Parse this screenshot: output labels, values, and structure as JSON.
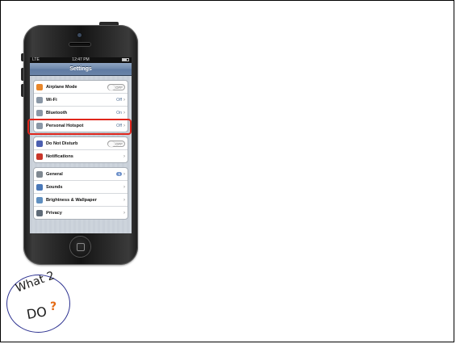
{
  "status_bar": {
    "carrier": "LTE",
    "time": "12:47 PM"
  },
  "navbar": {
    "title": "Settings"
  },
  "groups": [
    [
      {
        "label": "Airplane Mode",
        "control": "toggle",
        "value": "OFF",
        "icon": "airplane-icon",
        "icon_color": "#e8862a"
      },
      {
        "label": "Wi-Fi",
        "control": "value",
        "value": "Off",
        "icon": "wifi-icon",
        "icon_color": "#8a97a6"
      },
      {
        "label": "Bluetooth",
        "control": "value",
        "value": "On",
        "icon": "bluetooth-icon",
        "icon_color": "#8a97a6"
      },
      {
        "label": "Personal Hotspot",
        "control": "value",
        "value": "Off",
        "icon": "hotspot-icon",
        "icon_color": "#8a97a6"
      }
    ],
    [
      {
        "label": "Do Not Disturb",
        "control": "toggle",
        "value": "OFF",
        "icon": "moon-icon",
        "icon_color": "#4b5fb0"
      },
      {
        "label": "Notifications",
        "control": "chevron",
        "value": "",
        "icon": "notifications-icon",
        "icon_color": "#c9362a"
      }
    ],
    [
      {
        "label": "General",
        "control": "badge",
        "value": "1",
        "icon": "gear-icon",
        "icon_color": "#7f8891"
      },
      {
        "label": "Sounds",
        "control": "chevron",
        "value": "",
        "icon": "speaker-icon",
        "icon_color": "#4a78b8"
      },
      {
        "label": "Brightness & Wallpaper",
        "control": "chevron",
        "value": "",
        "icon": "brightness-icon",
        "icon_color": "#5f8fc0"
      },
      {
        "label": "Privacy",
        "control": "chevron",
        "value": "",
        "icon": "hand-icon",
        "icon_color": "#5f6b78"
      }
    ]
  ],
  "highlight": {
    "color": "#e0261c"
  },
  "stamp": {
    "line1": "What 2",
    "line2": "DO",
    "mark": "?",
    "ring_color": "#2a2f8f",
    "mark_color": "#e46b16"
  }
}
